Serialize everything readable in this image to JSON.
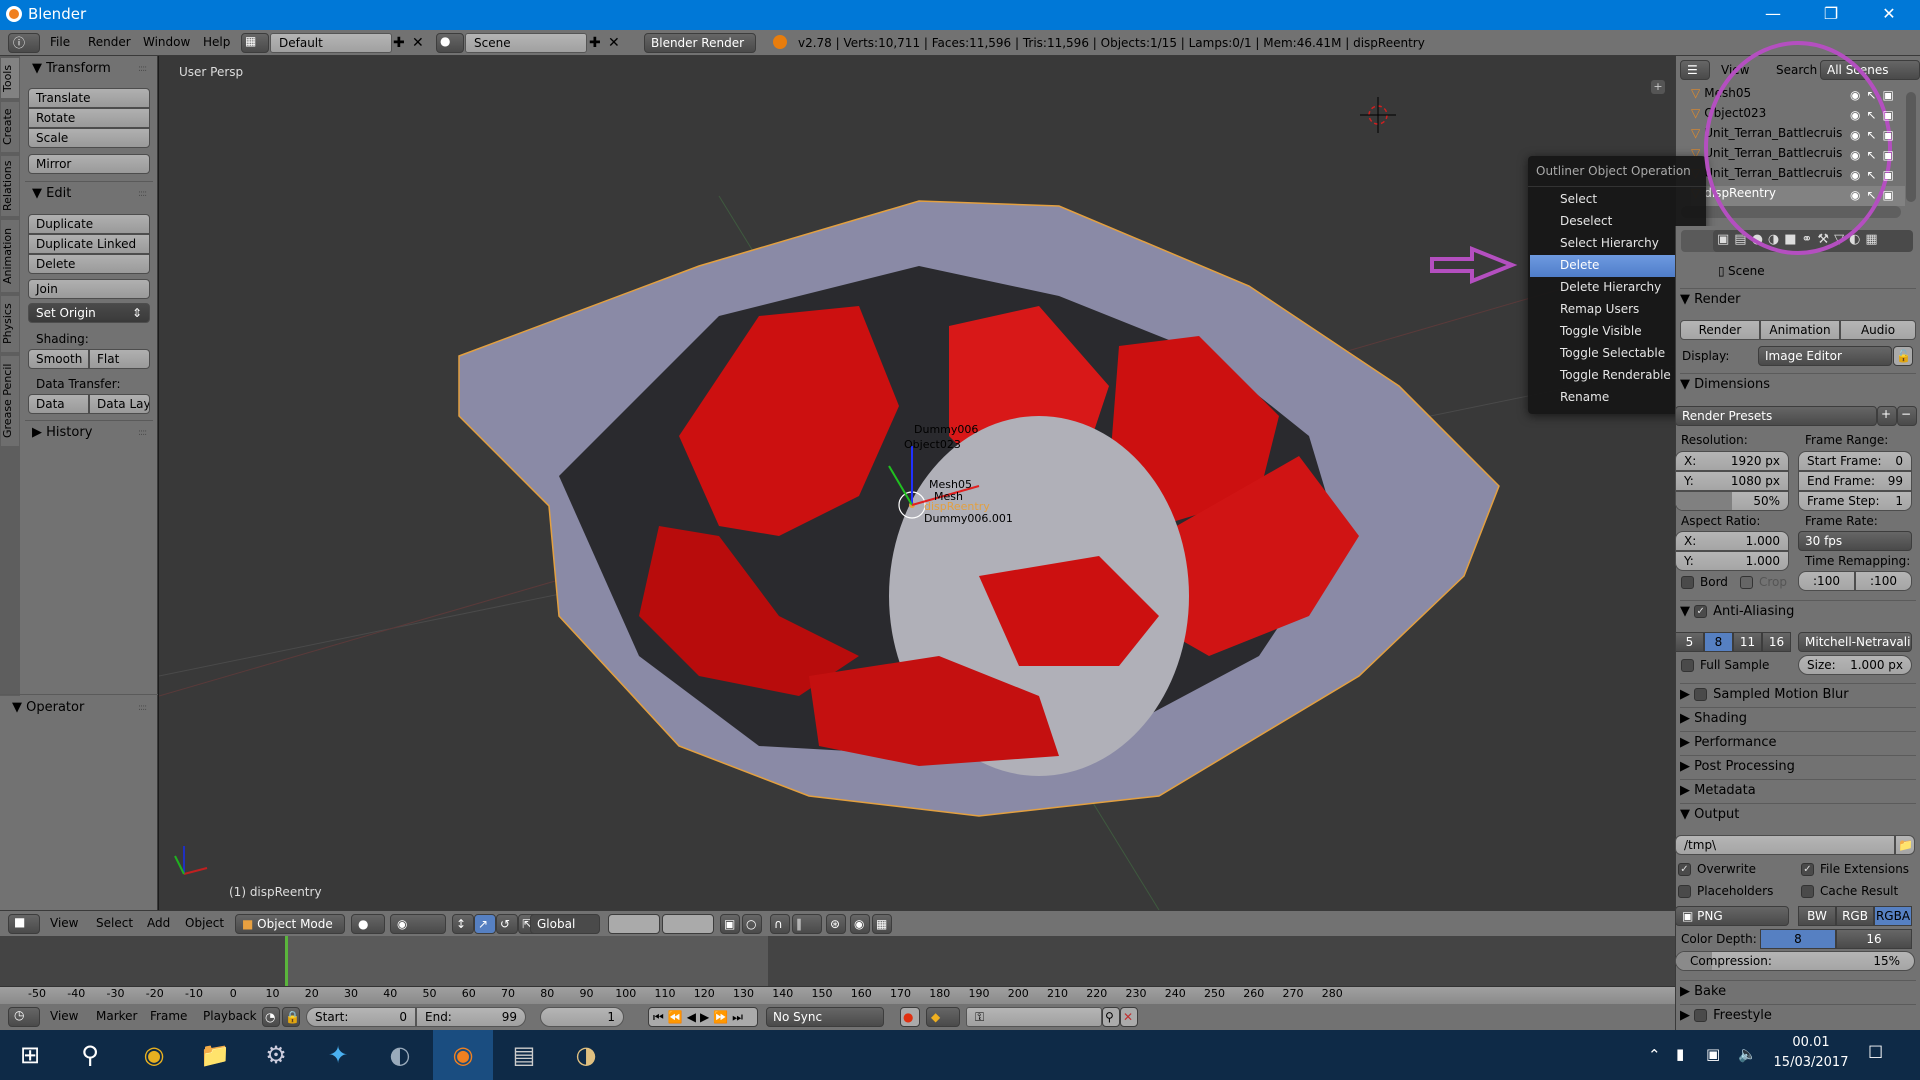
{
  "window": {
    "title": "Blender",
    "controls": [
      "minimize",
      "restore",
      "close"
    ]
  },
  "info_header": {
    "menus": [
      "File",
      "Render",
      "Window",
      "Help"
    ],
    "screen_layout": "Default",
    "scene": "Scene",
    "render_engine": "Blender Render",
    "stats": "v2.78 | Verts:10,711 | Faces:11,596 | Tris:11,596 | Objects:1/15 | Lamps:0/1 | Mem:46.41M | dispReentry"
  },
  "tool_tabs": [
    "Tools",
    "Create",
    "Relations",
    "Animation",
    "Physics",
    "Grease Pencil"
  ],
  "tool_shelf": {
    "transform": {
      "title": "Transform",
      "buttons": [
        "Translate",
        "Rotate",
        "Scale"
      ],
      "mirror": "Mirror"
    },
    "edit": {
      "title": "Edit",
      "buttons": [
        "Duplicate",
        "Duplicate Linked",
        "Delete"
      ],
      "join": "Join",
      "set_origin": "Set Origin",
      "shading_label": "Shading:",
      "shading": [
        "Smooth",
        "Flat"
      ],
      "data_transfer_label": "Data Transfer:",
      "data_transfer": [
        "Data",
        "Data Layo"
      ]
    },
    "history": "History",
    "operator": "Operator"
  },
  "viewport": {
    "view_label": "User Persp",
    "object_label": "(1) dispReentry",
    "scene_labels": [
      "Dummy006",
      "Object023",
      "Mesh05",
      "Mesh",
      "dispReentry",
      "Dummy006.001"
    ],
    "axes": [
      "x",
      "y",
      "z"
    ]
  },
  "view3d_header": {
    "menus": [
      "View",
      "Select",
      "Add",
      "Object"
    ],
    "mode": "Object Mode",
    "orientation": "Global"
  },
  "timeline": {
    "ticks": [
      "-50",
      "-40",
      "-30",
      "-20",
      "-10",
      "0",
      "10",
      "20",
      "30",
      "40",
      "50",
      "60",
      "70",
      "80",
      "90",
      "100",
      "110",
      "120",
      "130",
      "140",
      "150",
      "160",
      "170",
      "180",
      "190",
      "200",
      "210",
      "220",
      "230",
      "240",
      "250",
      "260",
      "270",
      "280"
    ],
    "current_frame_marker": 0,
    "menus": [
      "View",
      "Marker",
      "Frame",
      "Playback"
    ],
    "start_label": "Start:",
    "start": "0",
    "end_label": "End:",
    "end": "99",
    "current": "1",
    "sync": "No Sync"
  },
  "outliner": {
    "menus": [
      "View",
      "Search"
    ],
    "filter": "All Scenes",
    "rows": [
      {
        "name": "Mesh05",
        "selected": false
      },
      {
        "name": "Object023",
        "selected": false
      },
      {
        "name": "Unit_Terran_Battlecruis",
        "selected": false
      },
      {
        "name": "Unit_Terran_Battlecruis",
        "selected": false
      },
      {
        "name": "Unit_Terran_Battlecruis",
        "selected": false
      },
      {
        "name": "dispReentry",
        "selected": true
      }
    ]
  },
  "context_menu": {
    "title": "Outliner Object Operation",
    "items": [
      "Select",
      "Deselect",
      "Select Hierarchy",
      "Delete",
      "Delete Hierarchy",
      "Remap Users",
      "Toggle Visible",
      "Toggle Selectable",
      "Toggle Renderable",
      "Rename"
    ],
    "highlighted": "Delete"
  },
  "properties": {
    "context": "Scene",
    "render_panel": "Render",
    "render_buttons": [
      "Render",
      "Animation",
      "Audio"
    ],
    "display_label": "Display:",
    "display": "Image Editor",
    "dimensions_panel": "Dimensions",
    "render_presets": "Render Presets",
    "resolution_label": "Resolution:",
    "res_x": "1920 px",
    "res_y": "1080 px",
    "res_percent": "50%",
    "res_percent_value": 50,
    "frame_range_label": "Frame Range:",
    "start_frame_label": "Start Frame:",
    "start_frame": "0",
    "end_frame_label": "End Frame:",
    "end_frame": "99",
    "frame_step_label": "Frame Step:",
    "frame_step": "1",
    "aspect_label": "Aspect Ratio:",
    "aspect_x": "1.000",
    "aspect_y": "1.000",
    "frame_rate_label": "Frame Rate:",
    "frame_rate": "30 fps",
    "time_remap_label": "Time Remapping:",
    "time_old": ":100",
    "time_new": ":100",
    "bord": "Bord",
    "crop": "Crop",
    "aa_panel": "Anti-Aliasing",
    "aa_samples": [
      "5",
      "8",
      "11",
      "16"
    ],
    "aa_selected": "8",
    "aa_filter": "Mitchell-Netravali",
    "full_sample": "Full Sample",
    "size_label": "Size:",
    "size": "1.000 px",
    "collapsed_panels": [
      "Sampled Motion Blur",
      "Shading",
      "Performance",
      "Post Processing",
      "Metadata"
    ],
    "output_panel": "Output",
    "output_path": "/tmp\\",
    "overwrite": "Overwrite",
    "file_extensions": "File Extensions",
    "placeholders": "Placeholders",
    "cache_result": "Cache Result",
    "format": "PNG",
    "color_modes": [
      "BW",
      "RGB",
      "RGBA"
    ],
    "color_mode_selected": "RGBA",
    "color_depth_label": "Color Depth:",
    "color_depths": [
      "8",
      "16"
    ],
    "color_depth_selected": "8",
    "compression_label": "Compression:",
    "compression": "15%",
    "compression_value": 15,
    "bottom_panels": [
      "Bake",
      "Freestyle"
    ]
  },
  "taskbar": {
    "apps": [
      "Start",
      "Search",
      "Chrome",
      "File Explorer",
      "Steam",
      "Battle.net",
      "TeamSpeak",
      "Blender",
      "Resource Monitor",
      "Paint"
    ],
    "active": "Blender",
    "time": "00.01",
    "date": "15/03/2017"
  },
  "annotation_color": "#b44fc0",
  "accent_color": "#5680c2"
}
